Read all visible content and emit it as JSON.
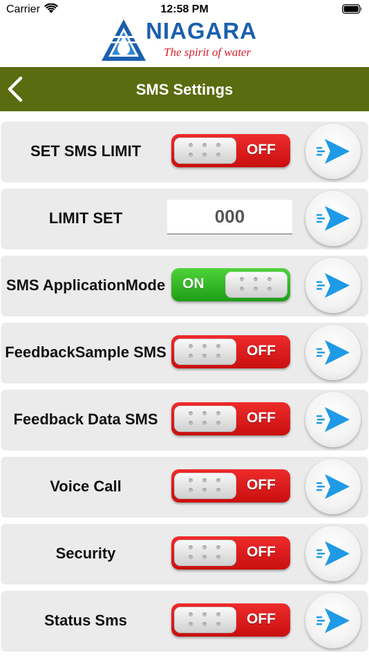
{
  "status_bar": {
    "carrier": "Carrier",
    "time": "12:58 PM"
  },
  "logo": {
    "name": "NIAGARA",
    "tagline": "The spirit of water"
  },
  "nav": {
    "title": "SMS Settings"
  },
  "colors": {
    "nav_bg": "#5a6b10",
    "toggle_off": "#d91a1a",
    "toggle_on": "#2fb523",
    "send_icon": "#1e9ae6"
  },
  "rows": [
    {
      "label_lines": [
        "SET SMS LIMIT"
      ],
      "control": "toggle",
      "state": "OFF"
    },
    {
      "label_lines": [
        "LIMIT SET"
      ],
      "control": "input",
      "value": "000"
    },
    {
      "label_lines": [
        "SMS Application",
        "Mode"
      ],
      "control": "toggle",
      "state": "ON"
    },
    {
      "label_lines": [
        "Feedback",
        "Sample SMS"
      ],
      "control": "toggle",
      "state": "OFF"
    },
    {
      "label_lines": [
        "Feedback Data SMS"
      ],
      "control": "toggle",
      "state": "OFF"
    },
    {
      "label_lines": [
        "Voice Call"
      ],
      "control": "toggle",
      "state": "OFF"
    },
    {
      "label_lines": [
        "Security"
      ],
      "control": "toggle",
      "state": "OFF"
    },
    {
      "label_lines": [
        "Status Sms"
      ],
      "control": "toggle",
      "state": "OFF"
    }
  ],
  "icons": {
    "back": "chevron-left-icon",
    "send": "send-icon",
    "wifi": "wifi-icon",
    "battery": "battery-icon"
  }
}
